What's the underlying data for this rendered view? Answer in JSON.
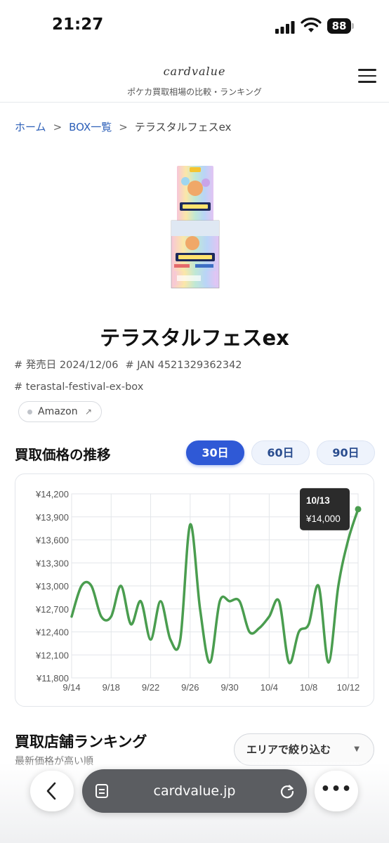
{
  "status": {
    "time": "21:27",
    "battery": "88"
  },
  "header": {
    "logo": "cardvalue",
    "tagline": "ポケカ買取相場の比較・ランキング"
  },
  "breadcrumb": {
    "home": "ホーム",
    "list": "BOX一覧",
    "current": "テラスタルフェスex"
  },
  "product": {
    "title": "テラスタルフェスex",
    "release": "# 発売日 2024/12/06",
    "jan": "# JAN 4521329362342",
    "slug": "# terastal-festival-ex-box",
    "store_link": "Amazon"
  },
  "chart_section": {
    "title": "買取価格の推移",
    "ranges": [
      "30日",
      "60日",
      "90日"
    ],
    "active_range": "30日"
  },
  "chart_data": {
    "type": "line",
    "x": [
      "9/14",
      "9/15",
      "9/16",
      "9/17",
      "9/18",
      "9/19",
      "9/20",
      "9/21",
      "9/22",
      "9/23",
      "9/24",
      "9/25",
      "9/26",
      "9/27",
      "9/28",
      "9/29",
      "9/30",
      "10/1",
      "10/2",
      "10/3",
      "10/4",
      "10/5",
      "10/6",
      "10/7",
      "10/8",
      "10/9",
      "10/10",
      "10/11",
      "10/12",
      "10/13"
    ],
    "values": [
      12600,
      13000,
      13000,
      12600,
      12600,
      13000,
      12500,
      12800,
      12300,
      12800,
      12300,
      12300,
      13800,
      12700,
      12000,
      12800,
      12800,
      12800,
      12400,
      12450,
      12600,
      12800,
      12000,
      12400,
      12500,
      13000,
      12000,
      13000,
      13600,
      14000
    ],
    "x_tick_labels": [
      "9/14",
      "9/18",
      "9/22",
      "9/26",
      "9/30",
      "10/4",
      "10/8",
      "10/12"
    ],
    "y_ticks": [
      "¥11,800",
      "¥12,100",
      "¥12,400",
      "¥12,700",
      "¥13,000",
      "¥13,300",
      "¥13,600",
      "¥13,900",
      "¥14,200"
    ],
    "ylim": [
      11800,
      14200
    ],
    "grid": true,
    "line_color": "#4a9d4f",
    "tooltip": {
      "date": "10/13",
      "value": "¥14,000"
    }
  },
  "ranking": {
    "title": "買取店舗ランキング",
    "subtitle": "最新価格が高い順",
    "area_filter": "エリアで絞り込む"
  },
  "browser": {
    "url": "cardvalue.jp"
  },
  "icons": {
    "back": "chevron-left-icon",
    "more": "more-dots-icon",
    "tabs": "tabs-icon",
    "reload": "reload-icon",
    "menu": "hamburger-icon"
  }
}
